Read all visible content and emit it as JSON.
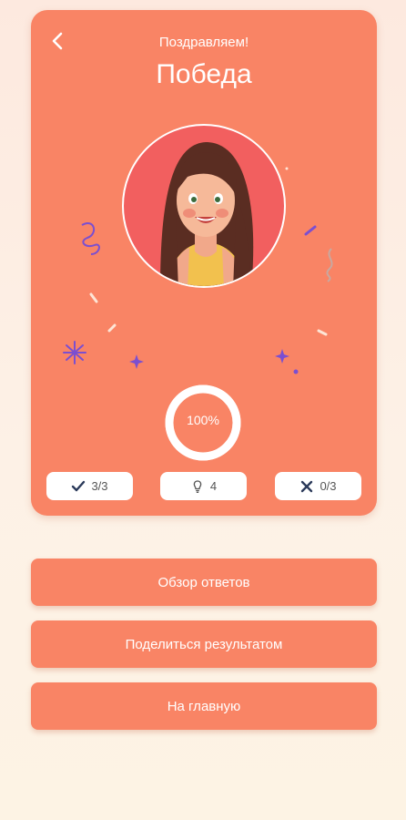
{
  "header": {
    "subtitle": "Поздравляем!",
    "title": "Победа"
  },
  "progress": {
    "label": "100%",
    "value": 100
  },
  "stats": {
    "correct": "3/3",
    "hints": "4",
    "wrong": "0/3"
  },
  "buttons": {
    "review": "Обзор ответов",
    "share": "Поделиться результатом",
    "home": "На главную"
  },
  "colors": {
    "accent": "#f98465",
    "avatar_bg": "#f25f5f",
    "confetti_purple": "#7b4fd0"
  },
  "icons": {
    "back": "chevron-left-icon",
    "correct": "check-icon",
    "hints": "hint-bulb-icon",
    "wrong": "cross-icon"
  }
}
